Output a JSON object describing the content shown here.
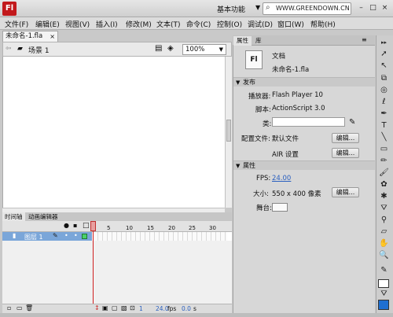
{
  "app": {
    "logo": "Fl",
    "workspace": "基本功能",
    "search": "WWW.GREENDOWN.CN"
  },
  "menubar": [
    "文件(F)",
    "编辑(E)",
    "视图(V)",
    "插入(I)",
    "修改(M)",
    "文本(T)",
    "命令(C)",
    "控制(O)",
    "调试(D)",
    "窗口(W)",
    "帮助(H)"
  ],
  "doc_tab": {
    "label": "未命名-1.fla",
    "close": "×"
  },
  "scene": {
    "label": "场景 1",
    "zoom": "100%"
  },
  "timeline": {
    "tabs": [
      "时间轴",
      "动画编辑器"
    ],
    "layer": "图层 1",
    "frame_numbers": [
      "5",
      "10",
      "15",
      "20",
      "25",
      "30"
    ],
    "footer": {
      "frame": "1",
      "fps": "24.0",
      "fps_unit": "fps",
      "time": "0.0",
      "time_unit": "s"
    }
  },
  "properties": {
    "tabs": [
      "属性",
      "库"
    ],
    "doc_icon": "Fl",
    "doc_type": "文档",
    "file_name": "未命名-1.fla",
    "publish": {
      "header": "发布",
      "player_label": "播放器:",
      "player_value": "Flash Player 10",
      "script_label": "脚本:",
      "script_value": "ActionScript 3.0",
      "class_label": "类:",
      "profile_label": "配置文件:",
      "profile_value": "默认文件",
      "edit1": "编辑...",
      "air_label": "AIR 设置",
      "edit2": "编辑..."
    },
    "props": {
      "header": "属性",
      "fps_label": "FPS:",
      "fps_value": "24.00",
      "size_label": "大小:",
      "size_value": "550 x 400 像素",
      "edit3": "编辑...",
      "stage_label": "舞台:"
    }
  },
  "colors": {
    "fill": "#1f6fd1",
    "stroke": "#ffffff",
    "logo": "#c2191c"
  },
  "tools": [
    "selection-tool",
    "subselection-tool",
    "free-transform-tool",
    "lasso-tool",
    "pen-tool",
    "text-tool",
    "line-tool",
    "rectangle-tool",
    "pencil-tool",
    "brush-tool",
    "deco-tool",
    "bone-tool",
    "paint-bucket-tool",
    "eyedropper-tool",
    "eraser-tool",
    "hand-tool",
    "zoom-tool"
  ]
}
